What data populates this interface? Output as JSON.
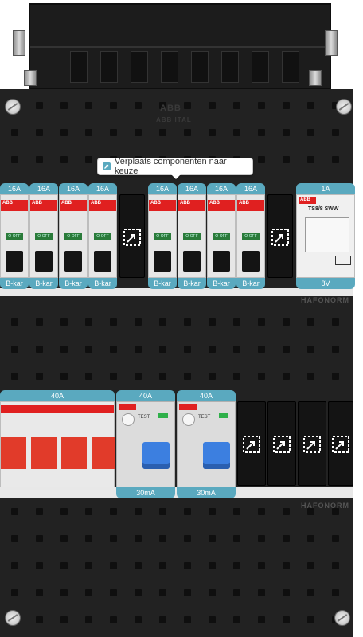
{
  "tooltip": {
    "text": "Verplaats componenten naar keuze",
    "icon": "move-icon"
  },
  "logo": {
    "text": "ABB",
    "sub": "ABB ITAL"
  },
  "watermark": {
    "row1": "HAFONORM",
    "row2": "HAFONORM"
  },
  "row1": {
    "breakers_left": [
      {
        "rating": "16A",
        "curve": "B-kar"
      },
      {
        "rating": "16A",
        "curve": "B-kar"
      },
      {
        "rating": "16A",
        "curve": "B-kar"
      },
      {
        "rating": "16A",
        "curve": "B-kar"
      }
    ],
    "breakers_right": [
      {
        "rating": "16A",
        "curve": "B-kar"
      },
      {
        "rating": "16A",
        "curve": "B-kar"
      },
      {
        "rating": "16A",
        "curve": "B-kar"
      },
      {
        "rating": "16A",
        "curve": "B-kar"
      }
    ],
    "breaker_brand": "ABB",
    "breaker_state": "O-OFF",
    "timer": {
      "rating": "1A",
      "voltage": "8V",
      "model": "TS8/8 SWW",
      "brand": "ABB"
    }
  },
  "row2": {
    "main_switch": {
      "rating": "40A"
    },
    "rcbos": [
      {
        "rating": "40A",
        "sensitivity": "30mA"
      },
      {
        "rating": "40A",
        "sensitivity": "30mA"
      }
    ],
    "rcbo_test_label": "TEST"
  },
  "colors": {
    "accent": "#5aa9bf",
    "panel": "#222222",
    "breaker_red": "#e02020",
    "rcd_blue": "#3c7fe0"
  }
}
